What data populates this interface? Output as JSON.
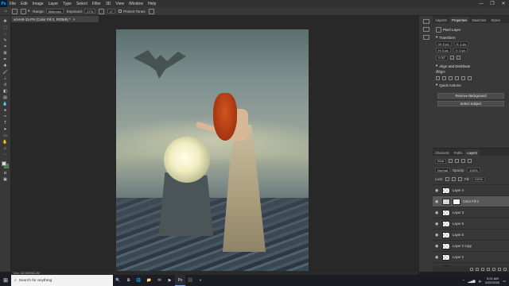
{
  "menubar": {
    "app_logo": "Ps",
    "items": [
      "File",
      "Edit",
      "Image",
      "Layer",
      "Type",
      "Select",
      "Filter",
      "3D",
      "View",
      "Window",
      "Help"
    ],
    "window_controls": [
      "—",
      "❐",
      "✕"
    ]
  },
  "options": {
    "range_label": "Range:",
    "range_value": "Midtones",
    "exposure_label": "Exposure:",
    "exposure_value": "27%",
    "angle_value": "0°",
    "protect_label": "Protect Tones"
  },
  "document": {
    "tab_title": "vd-6-B-15.PS (Color Fill 2, RGB/8) *",
    "close": "×"
  },
  "status": {
    "text": "Doc: 32.9M/563.3M"
  },
  "side_tabs": {
    "tabs": [
      "Adjustm",
      "Properties",
      "Swatches",
      "Styles"
    ],
    "active": 1
  },
  "properties": {
    "layer_kind": "Pixel Layer",
    "transform_title": "Transform",
    "w": "W: 0 px",
    "h": "H: 0 px",
    "x": "X: 1 px",
    "y": "Y: 0 px",
    "angle": "0.00°",
    "align_title": "Align and Distribute",
    "align_label": "Align:",
    "quick_title": "Quick Actions",
    "remove_bg": "Remove Background",
    "select_subject": "Select Subject"
  },
  "layers_panel": {
    "tabs": [
      "Channels",
      "Paths",
      "Layers"
    ],
    "active": 2,
    "kind_label": "Kind",
    "blend_mode": "Normal",
    "opacity_label": "Opacity:",
    "opacity_value": "100%",
    "lock_label": "Lock:",
    "fill_label": "Fill:",
    "fill_value": "100%",
    "rows": [
      {
        "name": "Layer 4",
        "type": "pixel",
        "selected": false
      },
      {
        "name": "Color Fill 2",
        "type": "adjustment",
        "selected": true
      },
      {
        "name": "Layer 3",
        "type": "pixel",
        "selected": false
      },
      {
        "name": "Layer 5",
        "type": "pixel",
        "selected": false
      },
      {
        "name": "Layer 6",
        "type": "pixel",
        "selected": false
      },
      {
        "name": "Layer 2 copy",
        "type": "pixel",
        "selected": false
      },
      {
        "name": "Layer 2",
        "type": "pixel",
        "selected": false
      },
      {
        "name": "Layer 1",
        "type": "pixel",
        "selected": false
      }
    ]
  },
  "taskbar": {
    "search_placeholder": "Search for anything",
    "apps": [
      "🔍",
      "⧉",
      "🌐",
      "📁",
      "✉",
      "▶",
      "Ps",
      "⬛",
      "◐"
    ],
    "active_app_index": 6,
    "time": "9:21 AM",
    "date": "8/22/2020"
  }
}
